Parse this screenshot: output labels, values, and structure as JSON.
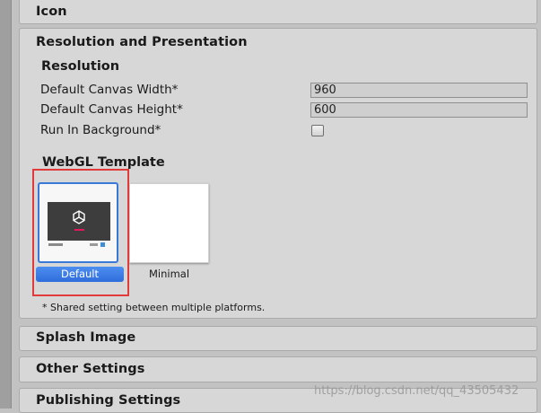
{
  "panels": {
    "icon": {
      "title": "Icon"
    },
    "resolution_presentation": {
      "title": "Resolution and Presentation",
      "resolution": {
        "title": "Resolution",
        "default_canvas_width_label": "Default Canvas Width*",
        "default_canvas_width_value": "960",
        "default_canvas_height_label": "Default Canvas Height*",
        "default_canvas_height_value": "600",
        "run_in_background_label": "Run In Background*",
        "run_in_background_checked": false
      },
      "webgl_template": {
        "title": "WebGL Template",
        "templates": [
          {
            "label": "Default",
            "selected": true
          },
          {
            "label": "Minimal",
            "selected": false
          }
        ]
      },
      "footnote": "* Shared setting between multiple platforms."
    },
    "splash_image": {
      "title": "Splash Image"
    },
    "other_settings": {
      "title": "Other Settings"
    },
    "publishing_settings": {
      "title": "Publishing Settings"
    }
  },
  "watermark": "https://blog.csdn.net/qq_43505432",
  "colors": {
    "selection_blue": "#3a79d7",
    "highlight_red": "#e03a3a",
    "panel_bg": "#d7d7d7",
    "unity_loading_pink": "#e3185c"
  }
}
